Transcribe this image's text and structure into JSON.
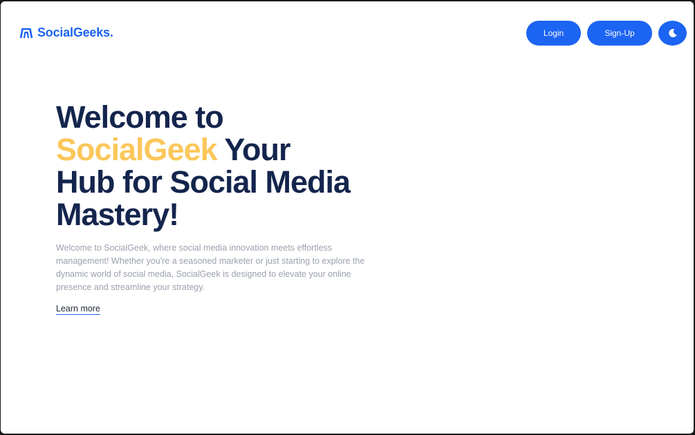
{
  "header": {
    "brand_name": "SocialGeeks.",
    "brand_icon": "arch-logo-icon",
    "login_label": "Login",
    "signup_label": "Sign-Up",
    "theme_toggle_icon": "moon-icon"
  },
  "hero": {
    "title_line1": "Welcome to",
    "title_accent": "SocialGeek",
    "title_after_accent": " Your",
    "title_line3": "Hub for Social Media",
    "title_line4": "Mastery!",
    "description": "Welcome to SocialGeek, where social media innovation meets effortless management! Whether you're a seasoned marketer or just starting to explore the dynamic world of social media, SocialGeek is designed to elevate your online presence and streamline your strategy.",
    "learn_more_label": "Learn more"
  },
  "colors": {
    "primary": "#1c64f2",
    "heading": "#14254d",
    "accent": "#fbc75a",
    "muted_text": "#9aa1ad"
  }
}
